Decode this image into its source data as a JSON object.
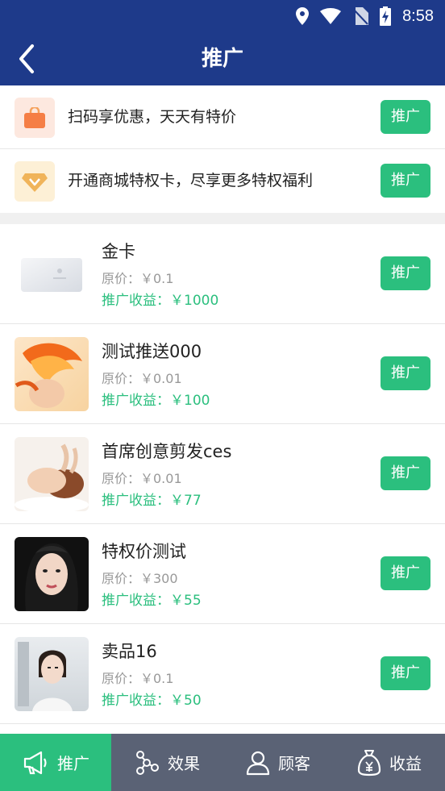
{
  "status": {
    "time": "8:58"
  },
  "nav": {
    "title": "推广"
  },
  "promos": [
    {
      "text": "扫码享优惠，天天有特价",
      "button": "推广",
      "icon": "shopping-bag-icon"
    },
    {
      "text": "开通商城特权卡，尽享更多特权福利",
      "button": "推广",
      "icon": "diamond-card-icon"
    }
  ],
  "products": [
    {
      "name": "金卡",
      "price": "原价：￥0.1",
      "earn": "推广收益：￥1000",
      "button": "推广"
    },
    {
      "name": "测试推送000",
      "price": "原价：￥0.01",
      "earn": "推广收益：￥100",
      "button": "推广"
    },
    {
      "name": "首席创意剪发ces",
      "price": "原价：￥0.01",
      "earn": "推广收益：￥77",
      "button": "推广"
    },
    {
      "name": "特权价测试",
      "price": "原价：￥300",
      "earn": "推广收益：￥55",
      "button": "推广"
    },
    {
      "name": "卖品16",
      "price": "原价：￥0.1",
      "earn": "推广收益：￥50",
      "button": "推广"
    }
  ],
  "tabs": [
    {
      "label": "推广",
      "icon": "megaphone-icon",
      "active": true
    },
    {
      "label": "效果",
      "icon": "network-icon",
      "active": false
    },
    {
      "label": "顾客",
      "icon": "user-icon",
      "active": false
    },
    {
      "label": "收益",
      "icon": "money-bag-icon",
      "active": false
    }
  ],
  "colors": {
    "header": "#1e3a8a",
    "accent": "#2bbf7e",
    "tabbar": "#5a6275"
  }
}
